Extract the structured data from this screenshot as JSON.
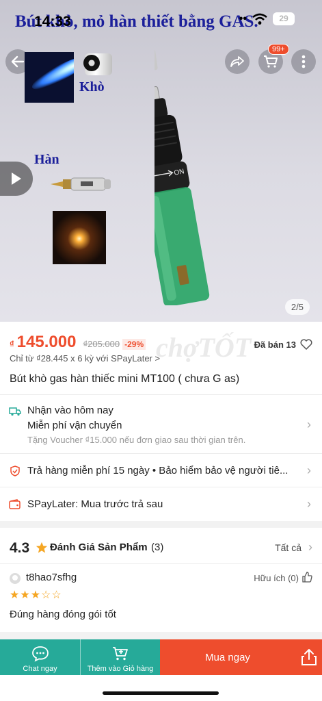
{
  "hero": {
    "caption": "Bút khò, mỏ hàn thiết bằng GAS.",
    "label_kho": "Khò",
    "label_han": "Hàn",
    "counter": "2/5",
    "cart_badge": "99+",
    "torch_on_label": "ON"
  },
  "status_bar": {
    "time": "14:33",
    "battery": "29"
  },
  "price": {
    "currency": "₫",
    "current": "145.000",
    "original": "₫205.000",
    "discount": "-29%",
    "sold": "Đã bán 13",
    "installment": "Chỉ từ ₫28.445 x 6 kỳ với SPayLater >",
    "watermark": "chợTỐT"
  },
  "product": {
    "name": "Bút khò gas hàn thiếc mini MT100 ( chưa G as)"
  },
  "shipping": {
    "line1": "Nhận vào hôm nay",
    "line2": "Miễn phí vận chuyển",
    "line3": "Tặng Voucher ₫15.000 nếu đơn giao sau thời gian trên."
  },
  "returns": {
    "text": "Trả hàng miễn phí 15 ngày  •  Bảo hiểm bảo vệ người tiê..."
  },
  "spaylater": {
    "text": "SPayLater: Mua trước trả sau"
  },
  "rating": {
    "score": "4.3",
    "title": "Đánh Giá Sản Phẩm",
    "count": "(3)",
    "see_all": "Tất cả",
    "reviewer": "t8hao7sfhg",
    "helpful": "Hữu ích (0)",
    "stars": "★★★☆☆",
    "review_value": 3,
    "review_text": "Đúng hàng đóng gói tốt"
  },
  "bottom_bar": {
    "chat": "Chat ngay",
    "add_cart": "Thêm vào Giỏ hàng",
    "buy_now": "Mua ngay"
  },
  "colors": {
    "accent": "#ee4d2d",
    "teal": "#26aa99"
  }
}
